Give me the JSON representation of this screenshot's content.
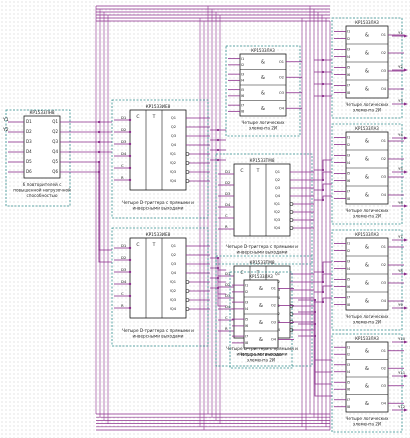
{
  "schematic": {
    "buffer": {
      "part": "КР1533ЛН8",
      "pins": {
        "inputs": [
          "D1",
          "D2",
          "D3",
          "D4",
          "D5",
          "D6"
        ],
        "outputs": [
          "Q1",
          "Q2",
          "Q3",
          "Q4",
          "Q5",
          "Q6"
        ]
      },
      "caption": "6 повторителей с повышенной нагрузочной способностью"
    },
    "counters": [
      {
        "part": "КР1533ИЕ8",
        "caption": "Четыре D-триггера с прямыми и инверсными выходами"
      },
      {
        "part": "КР1533ИЕ8",
        "caption": "Четыре D-триггера с прямыми и инверсными выходами"
      }
    ],
    "counter_pins": {
      "left": [
        "D1",
        "D2",
        "D3",
        "D4",
        "C",
        "R"
      ],
      "center": [
        "C",
        "T"
      ],
      "right": [
        "Q1",
        "Q2",
        "Q3",
        "Q4"
      ],
      "inverse": [
        "!Q1",
        "!Q2",
        "!Q3",
        "!Q4"
      ]
    },
    "registers": [
      {
        "part": "КР1533ТМ8",
        "caption": "Четыре D-триггера с прямыми и инверсными выходами"
      },
      {
        "part": "КР1533ТМ8",
        "caption": "Четыре D-триггера с прямыми и инверсными выходами"
      }
    ],
    "gate_label": "&",
    "gate_pins": {
      "inputs": [
        "I1",
        "I2",
        "I3",
        "I4",
        "I5",
        "I6",
        "I7",
        "I8"
      ],
      "outputs": [
        "O1",
        "O2",
        "O3",
        "O4"
      ]
    },
    "gates": [
      {
        "part": "КР1533ЛА3",
        "caption": "Четыре логических элемента 2И"
      },
      {
        "part": "КР1533ЛА3",
        "caption": "Четыре логических элемента 2И"
      },
      {
        "part": "КР1533ЛА3",
        "caption": "Четыре логических элемента 2И"
      },
      {
        "part": "КР1533ЛА3",
        "caption": "Четыре логических элемента 2И"
      },
      {
        "part": "КР1533ЛА3",
        "caption": "Четыре логических элемента 2И"
      },
      {
        "part": "КР1533ЛА3",
        "caption": "Четыре логических элемента 2И"
      }
    ],
    "colors": {
      "wire": "#8b2d8b",
      "frame": "#2e8b8b",
      "chip": "#1a1a1a",
      "label": "#d02030"
    },
    "net_labels": [
      "Y1",
      "Y2",
      "Y3",
      "Y4",
      "Y5",
      "Y6",
      "Y7",
      "Y8",
      "Y9",
      "Y10",
      "Y11",
      "Y12"
    ]
  }
}
